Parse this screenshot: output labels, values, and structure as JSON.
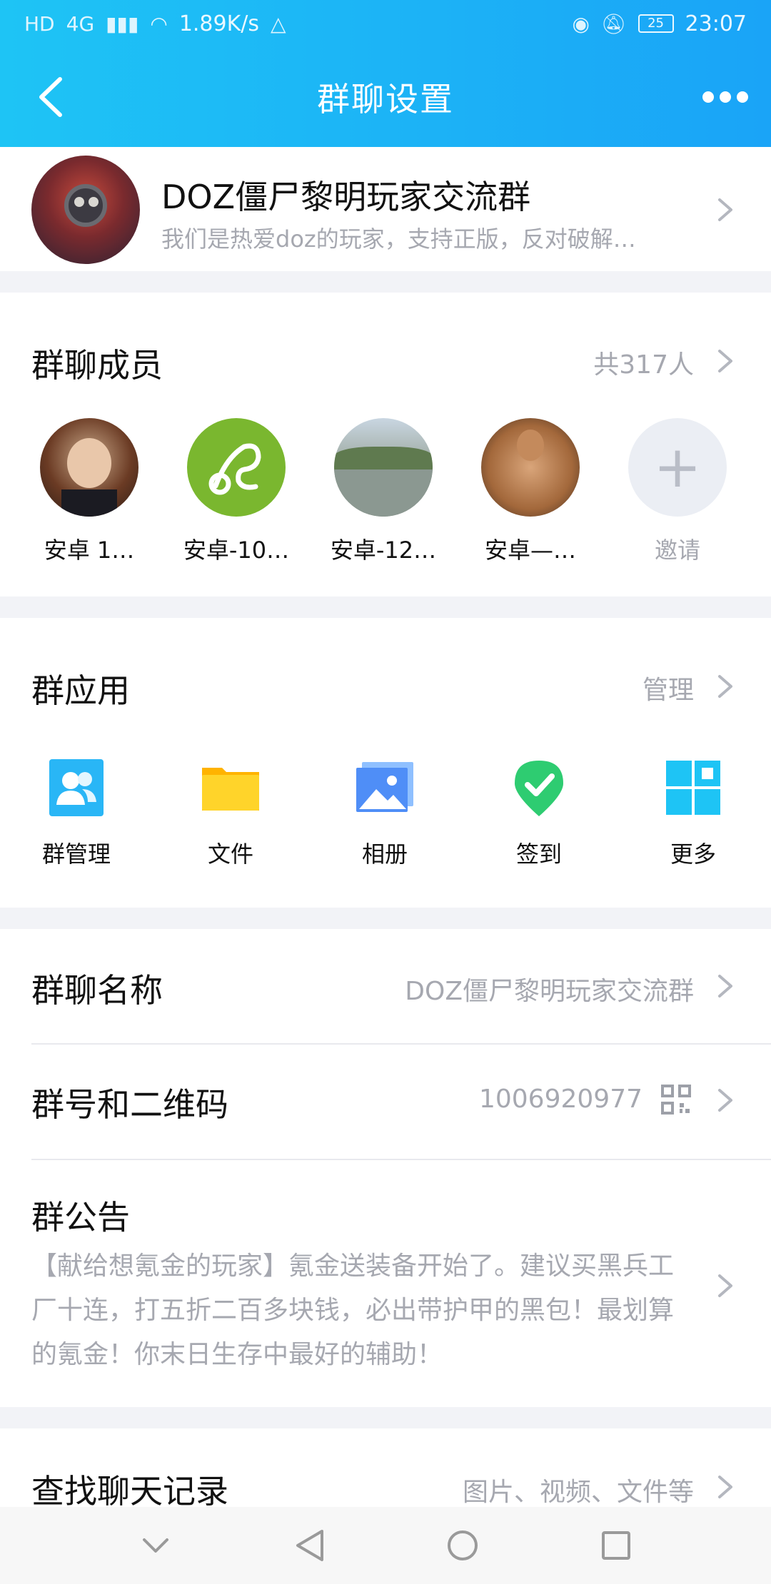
{
  "status_bar": {
    "network_speed": "1.89K/s",
    "network_type": "4G",
    "battery": "25",
    "time": "23:07"
  },
  "header": {
    "title": "群聊设置"
  },
  "group": {
    "name": "DOZ僵尸黎明玩家交流群",
    "description": "我们是热爱doz的玩家，支持正版，反对破解…"
  },
  "members": {
    "title": "群聊成员",
    "count_label": "共317人",
    "items": [
      {
        "name": "安卓 1…"
      },
      {
        "name": "安卓-10…"
      },
      {
        "name": "安卓-12…"
      },
      {
        "name": "安卓—…"
      }
    ],
    "invite_label": "邀请"
  },
  "apps": {
    "title": "群应用",
    "manage_label": "管理",
    "items": [
      {
        "label": "群管理",
        "icon": "group-manage-icon",
        "color": "#29b6f6"
      },
      {
        "label": "文件",
        "icon": "folder-icon",
        "color": "#ffc107"
      },
      {
        "label": "相册",
        "icon": "photo-album-icon",
        "color": "#4f8ef7"
      },
      {
        "label": "签到",
        "icon": "checkin-icon",
        "color": "#2ecc71"
      },
      {
        "label": "更多",
        "icon": "more-apps-icon",
        "color": "#1ec4f5"
      }
    ]
  },
  "settings": {
    "group_name_label": "群聊名称",
    "group_name_value": "DOZ僵尸黎明玩家交流群",
    "group_number_label": "群号和二维码",
    "group_number_value": "1006920977",
    "notice_label": "群公告",
    "notice_text": "【献给想氪金的玩家】氪金送装备开始了。建议买黑兵工厂十连，打五折二百多块钱，必出带护甲的黑包！最划算的氪金！你末日生存中最好的辅助！",
    "search_label": "查找聊天记录",
    "search_value": "图片、视频、文件等"
  },
  "colors": {
    "header_start": "#1ec4f5",
    "header_end": "#1aa4f7",
    "secondary_text": "#a6a8b0",
    "page_background": "#f2f3f7"
  }
}
